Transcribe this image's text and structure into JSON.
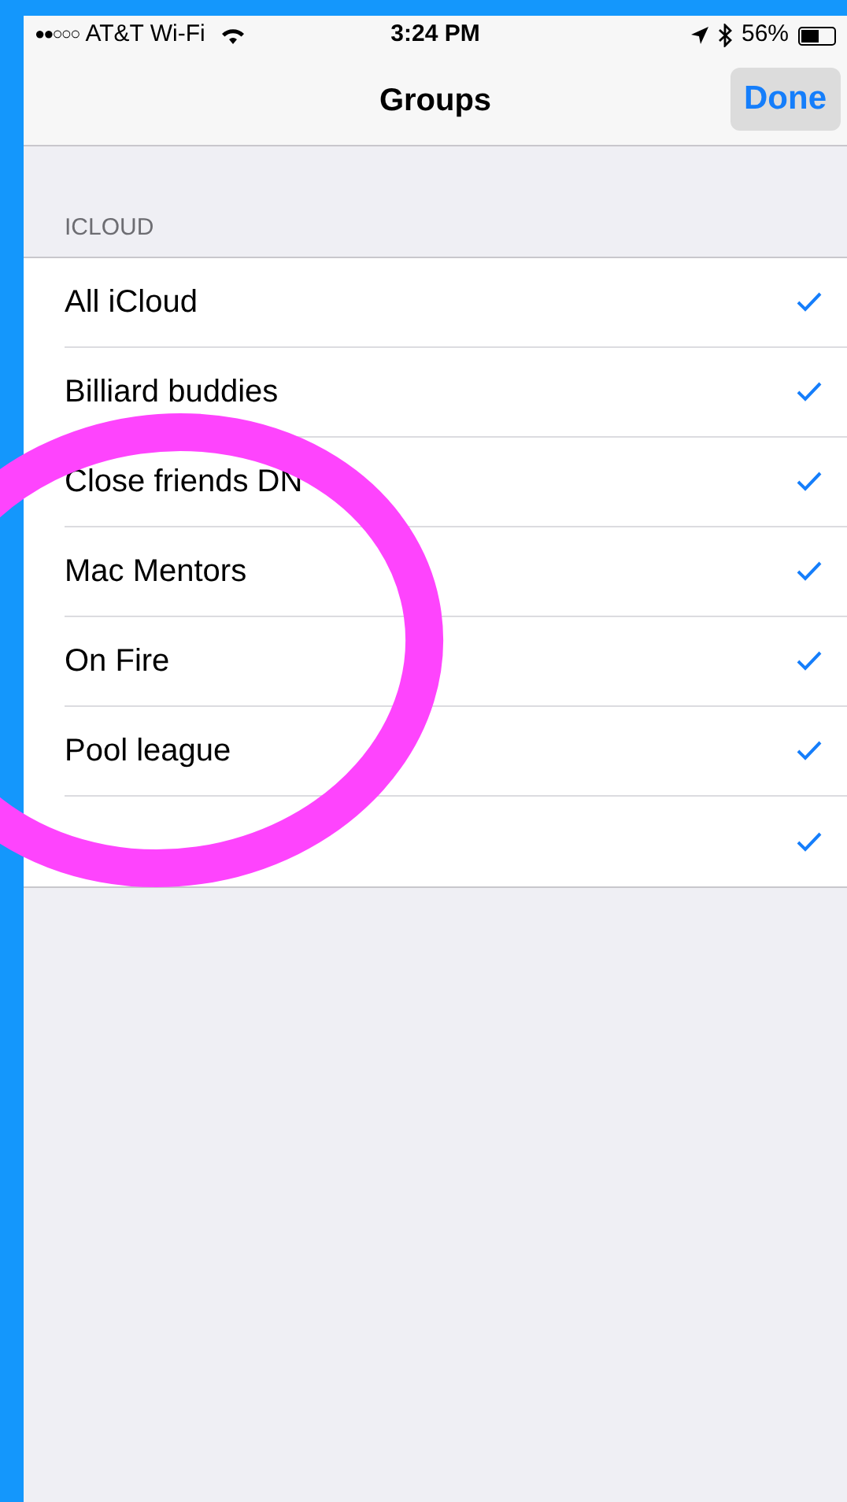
{
  "status_bar": {
    "signal_bars": "●●○○○",
    "carrier": "AT&T Wi-Fi",
    "time": "3:24 PM",
    "battery": "56%"
  },
  "nav": {
    "title": "Groups",
    "done": "Done"
  },
  "section": {
    "header": "ICLOUD"
  },
  "groups": [
    {
      "label": "All iCloud",
      "checked": true
    },
    {
      "label": "Billiard buddies",
      "checked": true
    },
    {
      "label": "Close friends DN",
      "checked": true
    },
    {
      "label": "Mac Mentors",
      "checked": true
    },
    {
      "label": "On Fire",
      "checked": true
    },
    {
      "label": "Pool league",
      "checked": true
    },
    {
      "checked": true
    }
  ]
}
